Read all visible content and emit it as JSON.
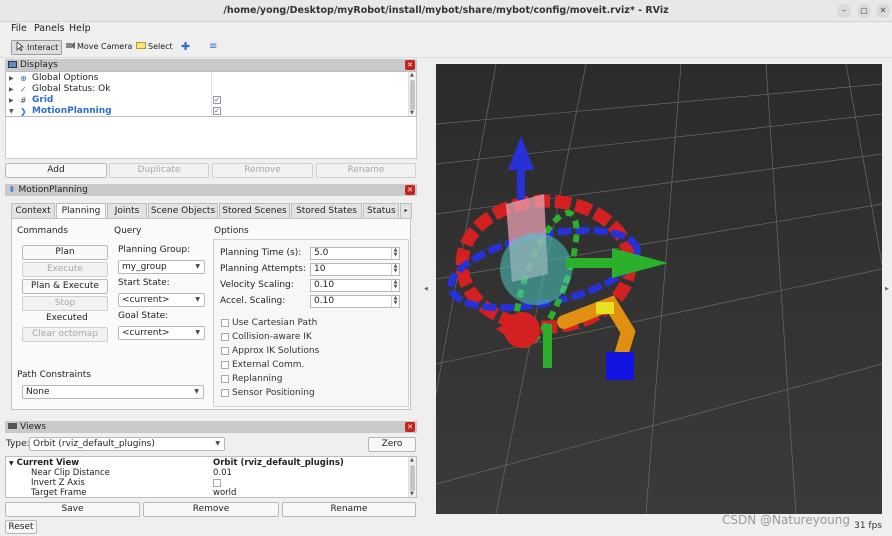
{
  "window": {
    "title": "/home/yong/Desktop/myRobot/install/mybot/share/mybot/config/moveit.rviz* - RViz",
    "controls": [
      "–",
      "▢",
      "✕"
    ]
  },
  "menu": {
    "file": "File",
    "panels": "Panels",
    "help": "Help"
  },
  "toolbar": {
    "interact": "Interact",
    "move_camera": "Move Camera",
    "select": "Select"
  },
  "displays": {
    "title": "Displays",
    "items": [
      {
        "label": "Global Options",
        "checked": ""
      },
      {
        "label": "Global Status: Ok",
        "checked": ""
      },
      {
        "label": "Grid",
        "checked": "✓"
      },
      {
        "label": "MotionPlanning",
        "checked": "✓"
      }
    ],
    "buttons": {
      "add": "Add",
      "duplicate": "Duplicate",
      "remove": "Remove",
      "rename": "Rename"
    }
  },
  "motion_planning": {
    "title": "MotionPlanning",
    "tabs": [
      "Context",
      "Planning",
      "Joints",
      "Scene Objects",
      "Stored Scenes",
      "Stored States",
      "Status"
    ],
    "selected_tab": "Planning",
    "commands": {
      "heading": "Commands",
      "plan": "Plan",
      "execute": "Execute",
      "plan_execute": "Plan & Execute",
      "stop": "Stop",
      "status": "Executed",
      "clear_octomap": "Clear octomap"
    },
    "query": {
      "heading": "Query",
      "planning_group_label": "Planning Group:",
      "planning_group": "my_group",
      "start_state_label": "Start State:",
      "start_state": "<current>",
      "goal_state_label": "Goal State:",
      "goal_state": "<current>"
    },
    "options": {
      "heading": "Options",
      "planning_time_label": "Planning Time (s):",
      "planning_time": "5.0",
      "planning_attempts_label": "Planning Attempts:",
      "planning_attempts": "10",
      "velocity_scaling_label": "Velocity Scaling:",
      "velocity_scaling": "0.10",
      "accel_scaling_label": "Accel. Scaling:",
      "accel_scaling": "0.10",
      "checkboxes": [
        "Use Cartesian Path",
        "Collision-aware IK",
        "Approx IK Solutions",
        "External Comm.",
        "Replanning",
        "Sensor Positioning"
      ]
    },
    "path_constraints": {
      "label": "Path Constraints",
      "value": "None"
    }
  },
  "views": {
    "title": "Views",
    "type_label": "Type:",
    "type_value": "Orbit (rviz_default_plugins)",
    "zero": "Zero",
    "rows": [
      {
        "name": "Current View",
        "value": "Orbit (rviz_default_plugins)"
      },
      {
        "name": "Near Clip Distance",
        "value": "0.01"
      },
      {
        "name": "Invert Z Axis",
        "value": ""
      },
      {
        "name": "Target Frame",
        "value": "world"
      }
    ],
    "buttons": {
      "save": "Save",
      "remove": "Remove",
      "rename": "Rename"
    }
  },
  "statusbar": {
    "reset": "Reset",
    "fps": "31 fps"
  },
  "watermark": "CSDN @Natureyoung"
}
